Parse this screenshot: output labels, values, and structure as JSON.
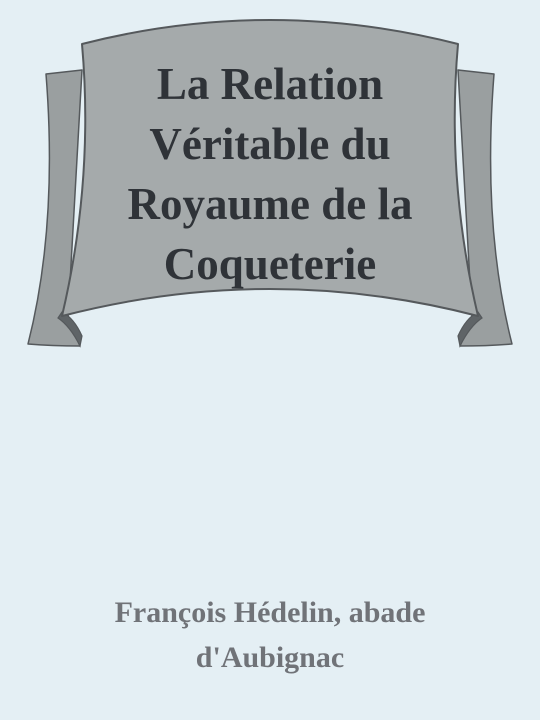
{
  "book": {
    "title": "La Relation Véritable du Royaume de la Coqueterie",
    "author": "François Hédelin, abade d'Aubignac"
  },
  "colors": {
    "background": "#e4eff4",
    "banner_fill": "#a5aaab",
    "banner_fold": "#9a9fa0",
    "banner_shadow": "#5f6467",
    "banner_outline": "#55595c",
    "title_text": "#2f3338",
    "author_text": "#707378"
  }
}
